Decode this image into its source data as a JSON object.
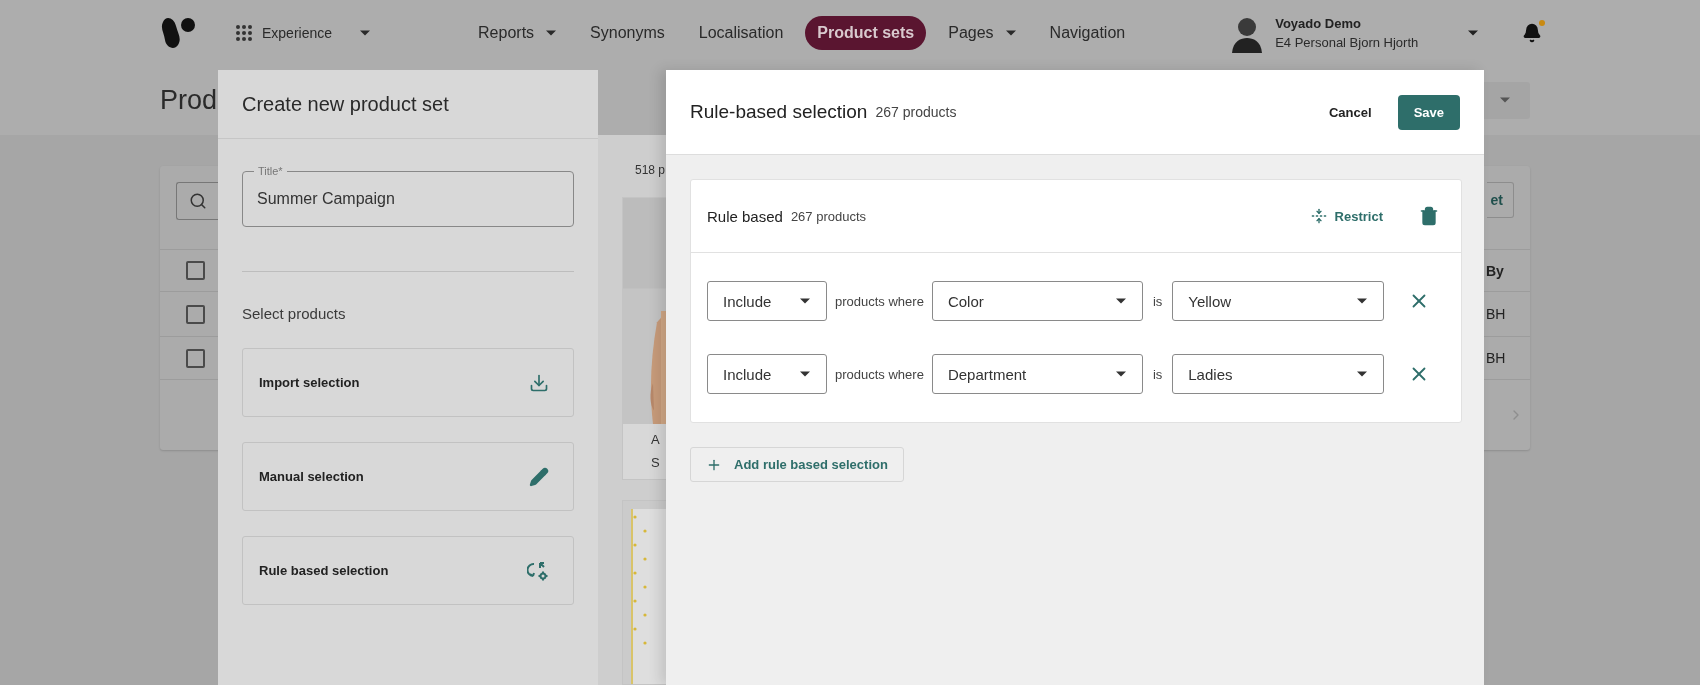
{
  "nav": {
    "menu": "Experience",
    "items": [
      {
        "label": "Reports",
        "dropdown": true,
        "selected": false
      },
      {
        "label": "Synonyms",
        "dropdown": false,
        "selected": false
      },
      {
        "label": "Localisation",
        "dropdown": false,
        "selected": false
      },
      {
        "label": "Product sets",
        "dropdown": false,
        "selected": true
      },
      {
        "label": "Pages",
        "dropdown": true,
        "selected": false
      },
      {
        "label": "Navigation",
        "dropdown": false,
        "selected": false
      }
    ],
    "user": {
      "name": "Voyado Demo",
      "account": "E4 Personal Bjorn Hjorth"
    },
    "notifications": {
      "unread": true
    }
  },
  "page": {
    "title": "Prod",
    "filter_button": "et",
    "table": {
      "header_checked": false,
      "column": "By",
      "rows": [
        {
          "checked": false,
          "by": "BH"
        },
        {
          "checked": false,
          "by": "BH"
        }
      ]
    }
  },
  "create_panel": {
    "title": "Create new product set",
    "title_field": {
      "label": "Title*",
      "value": "Summer Campaign"
    },
    "section": "Select products",
    "options": [
      {
        "label": "Import selection",
        "kind": "import"
      },
      {
        "label": "Manual selection",
        "kind": "manual"
      },
      {
        "label": "Rule based selection",
        "kind": "rule"
      }
    ]
  },
  "product_grid": {
    "count": "518 p",
    "products": [
      {
        "kind": "arm",
        "name": "A",
        "line_2": "S"
      },
      {
        "kind": "dots"
      }
    ]
  },
  "rule_panel": {
    "title": "Rule-based selection",
    "count": "267 products",
    "cancel": "Cancel",
    "save": "Save",
    "group": {
      "title": "Rule based",
      "count": "267 products",
      "restrict": "Restrict",
      "rules": [
        {
          "mode": "Include",
          "connector": "products where",
          "attribute": "Color",
          "operator": "is",
          "value": "Yellow"
        },
        {
          "mode": "Include",
          "connector": "products where",
          "attribute": "Department",
          "operator": "is",
          "value": "Ladies"
        }
      ]
    },
    "add_button": "Add rule based selection"
  }
}
